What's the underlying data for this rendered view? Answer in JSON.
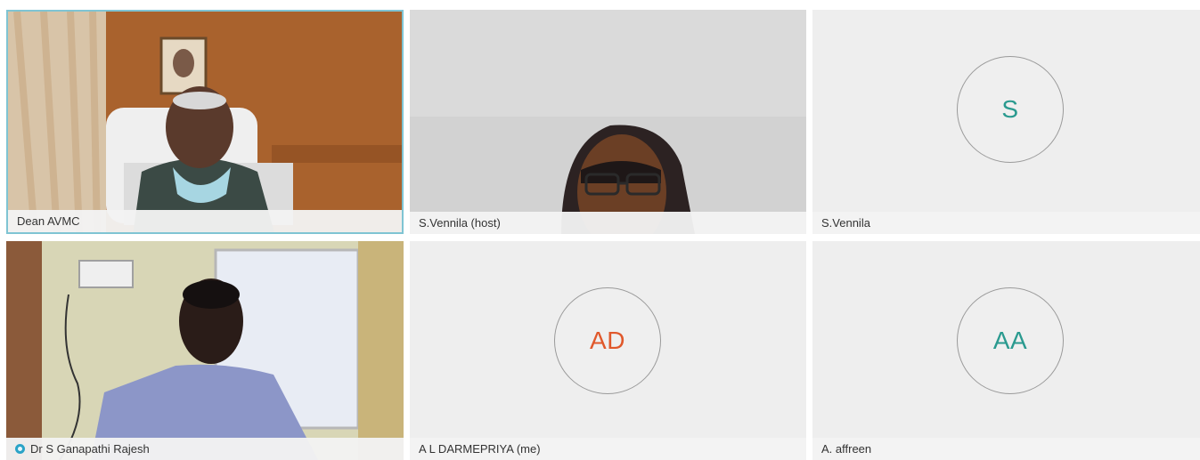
{
  "participants": [
    {
      "name": "Dean AVMC",
      "type": "video"
    },
    {
      "name": "S.Vennila (host)",
      "type": "video"
    },
    {
      "name": "S.Vennila",
      "type": "avatar",
      "initials": "S",
      "initials_color": "#2a9a8f"
    },
    {
      "name": "Dr S Ganapathi Rajesh",
      "type": "video",
      "speaking_icon": "speaking-icon"
    },
    {
      "name": "A L DARMEPRIYA (me)",
      "type": "avatar",
      "initials": "AD",
      "initials_color": "#e0582b"
    },
    {
      "name": "A. affreen",
      "type": "avatar",
      "initials": "AA",
      "initials_color": "#2a9a8f"
    }
  ]
}
